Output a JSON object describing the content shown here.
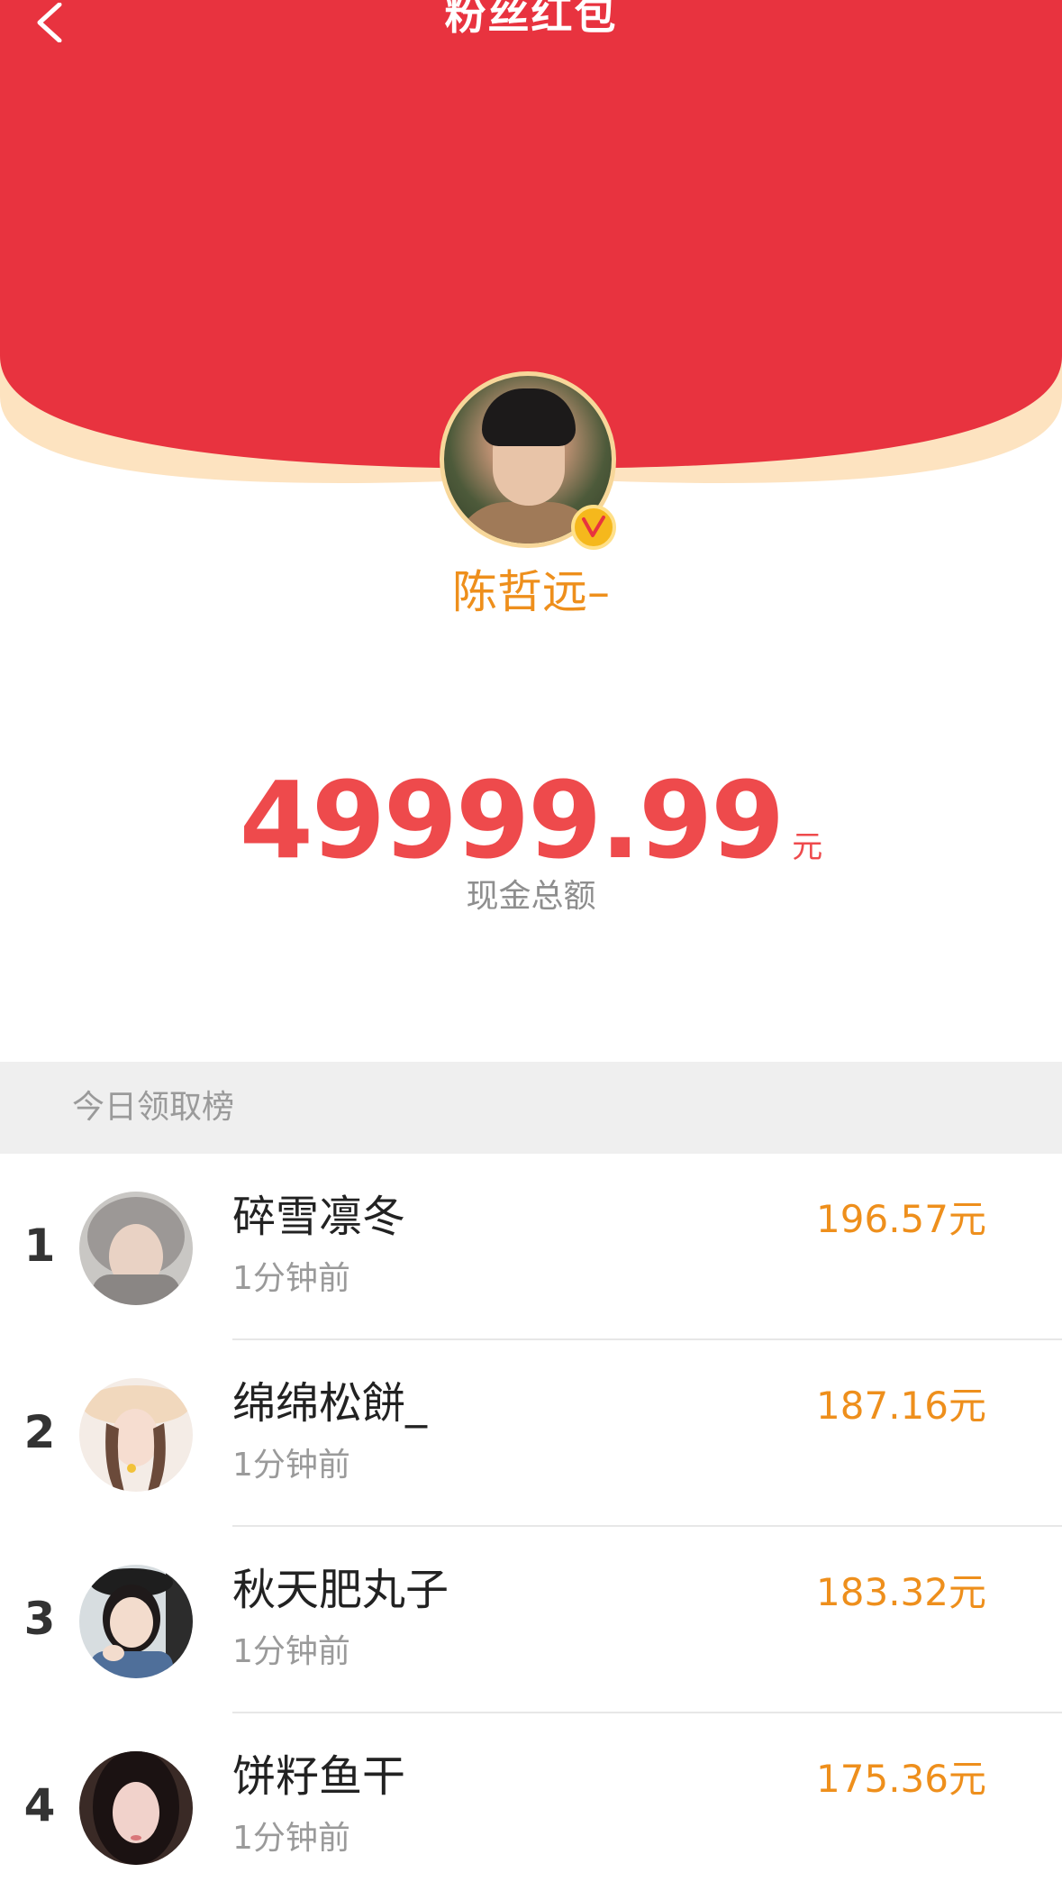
{
  "header": {
    "title": "粉丝红包",
    "back_icon": "chevron-left-icon",
    "colors": {
      "red": "#e8333f",
      "rim": "#fde3c0"
    }
  },
  "host": {
    "name": "陈哲远–",
    "badge_icon": "v-verified-icon"
  },
  "summary": {
    "amount": "49999.99",
    "currency": "元",
    "caption": "现金总额"
  },
  "ranking": {
    "title": "今日领取榜",
    "items": [
      {
        "rank": "1",
        "name": "碎雪凛冬",
        "time": "1分钟前",
        "amount": "196.57元"
      },
      {
        "rank": "2",
        "name": "绵绵松餅_",
        "time": "1分钟前",
        "amount": "187.16元"
      },
      {
        "rank": "3",
        "name": "秋天肥丸子",
        "time": "1分钟前",
        "amount": "183.32元"
      },
      {
        "rank": "4",
        "name": "饼籽鱼干",
        "time": "1分钟前",
        "amount": "175.36元"
      }
    ]
  }
}
